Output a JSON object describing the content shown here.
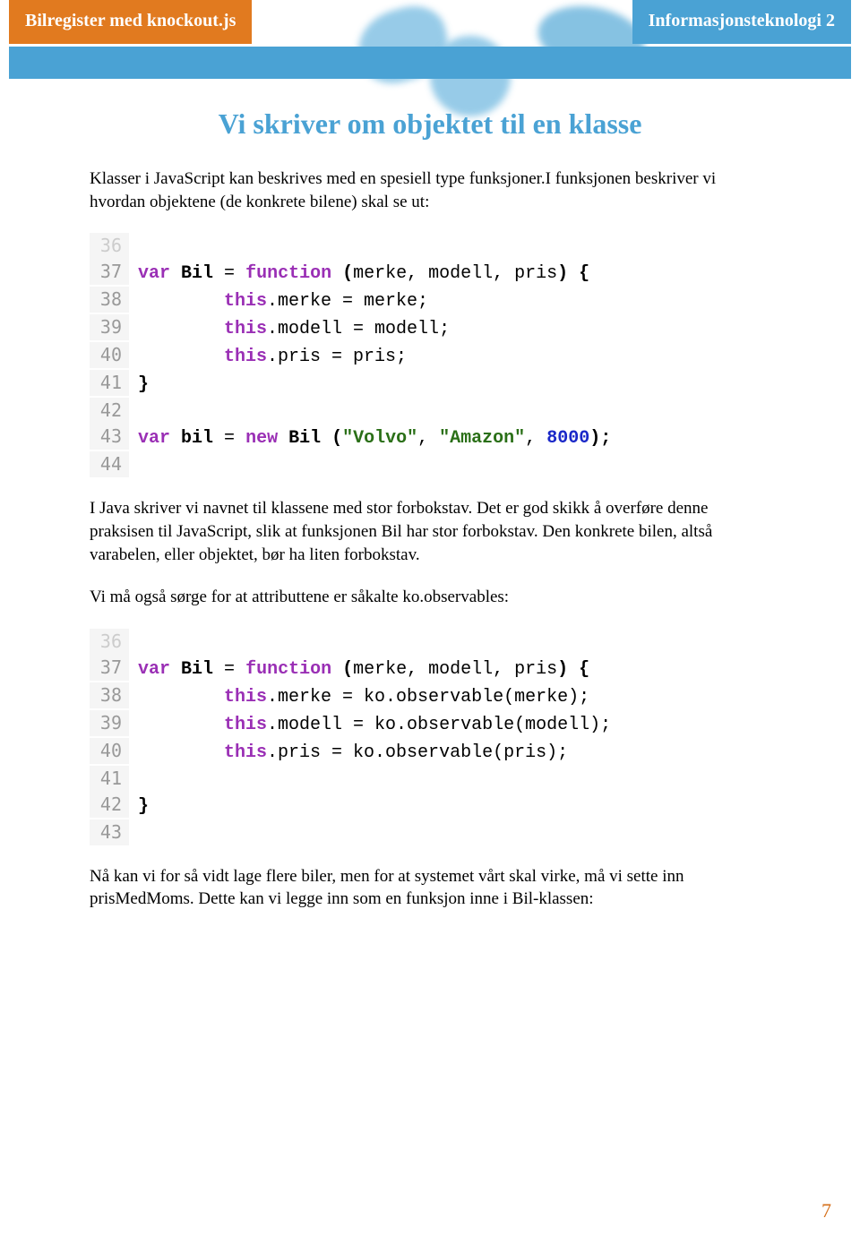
{
  "header": {
    "left_tab": "Bilregister med knockout.js",
    "right_tab": "Informasjonsteknologi 2"
  },
  "headings": {
    "title": "Vi skriver om objektet til en klasse"
  },
  "paragraphs": {
    "p1": "Klasser i JavaScript kan beskrives med en spesiell type funksjoner.I funksjonen beskriver vi hvordan objektene (de konkrete bilene) skal se ut:",
    "p2": "I Java skriver vi navnet til klassene med stor forbokstav. Det er god skikk å overføre denne praksisen til JavaScript, slik at funksjonen Bil har stor forbokstav. Den konkrete bilen, altså varabelen, eller objektet, bør ha liten forbokstav.",
    "p3": "Vi må også sørge for at attributtene er såkalte ko.observables:",
    "p4": "Nå kan vi for så vidt lage flere biler, men for at systemet vårt skal virke, må vi sette inn prisMedMoms. Dette kan vi legge inn som en funksjon inne i Bil-klassen:"
  },
  "code1": {
    "lines": [
      {
        "num": "36",
        "faint": true,
        "tokens": []
      },
      {
        "num": "37",
        "tokens": [
          {
            "t": "kw",
            "v": "var"
          },
          {
            "t": "plain",
            "v": " "
          },
          {
            "t": "id",
            "v": "Bil"
          },
          {
            "t": "plain",
            "v": " = "
          },
          {
            "t": "kw",
            "v": "function"
          },
          {
            "t": "plain",
            "v": " "
          },
          {
            "t": "paren",
            "v": "("
          },
          {
            "t": "plain",
            "v": "merke, modell, pris"
          },
          {
            "t": "paren",
            "v": ") {"
          }
        ]
      },
      {
        "num": "38",
        "indent": 2,
        "tokens": [
          {
            "t": "thisk",
            "v": "this"
          },
          {
            "t": "plain",
            "v": ".merke = merke;"
          }
        ]
      },
      {
        "num": "39",
        "indent": 2,
        "tokens": [
          {
            "t": "thisk",
            "v": "this"
          },
          {
            "t": "plain",
            "v": ".modell = modell;"
          }
        ]
      },
      {
        "num": "40",
        "indent": 2,
        "tokens": [
          {
            "t": "thisk",
            "v": "this"
          },
          {
            "t": "plain",
            "v": ".pris = pris;"
          }
        ]
      },
      {
        "num": "41",
        "tokens": [
          {
            "t": "paren",
            "v": "}"
          }
        ]
      },
      {
        "num": "42",
        "tokens": []
      },
      {
        "num": "43",
        "tokens": [
          {
            "t": "kw",
            "v": "var"
          },
          {
            "t": "plain",
            "v": " "
          },
          {
            "t": "id",
            "v": "bil"
          },
          {
            "t": "plain",
            "v": " = "
          },
          {
            "t": "kw",
            "v": "new"
          },
          {
            "t": "plain",
            "v": " "
          },
          {
            "t": "id",
            "v": "Bil"
          },
          {
            "t": "plain",
            "v": " "
          },
          {
            "t": "paren",
            "v": "("
          },
          {
            "t": "str",
            "v": "\"Volvo\""
          },
          {
            "t": "plain",
            "v": ", "
          },
          {
            "t": "str",
            "v": "\"Amazon\""
          },
          {
            "t": "plain",
            "v": ", "
          },
          {
            "t": "num",
            "v": "8000"
          },
          {
            "t": "paren",
            "v": ");"
          }
        ]
      },
      {
        "num": "44",
        "tokens": []
      }
    ]
  },
  "code2": {
    "lines": [
      {
        "num": "36",
        "faint": true,
        "tokens": []
      },
      {
        "num": "37",
        "tokens": [
          {
            "t": "kw",
            "v": "var"
          },
          {
            "t": "plain",
            "v": " "
          },
          {
            "t": "id",
            "v": "Bil"
          },
          {
            "t": "plain",
            "v": " = "
          },
          {
            "t": "kw",
            "v": "function"
          },
          {
            "t": "plain",
            "v": " "
          },
          {
            "t": "paren",
            "v": "("
          },
          {
            "t": "plain",
            "v": "merke, modell, pris"
          },
          {
            "t": "paren",
            "v": ") {"
          }
        ]
      },
      {
        "num": "38",
        "indent": 2,
        "tokens": [
          {
            "t": "thisk",
            "v": "this"
          },
          {
            "t": "plain",
            "v": ".merke = ko.observable(merke);"
          }
        ]
      },
      {
        "num": "39",
        "indent": 2,
        "tokens": [
          {
            "t": "thisk",
            "v": "this"
          },
          {
            "t": "plain",
            "v": ".modell = ko.observable(modell);"
          }
        ]
      },
      {
        "num": "40",
        "indent": 2,
        "tokens": [
          {
            "t": "thisk",
            "v": "this"
          },
          {
            "t": "plain",
            "v": ".pris = ko.observable(pris);"
          }
        ]
      },
      {
        "num": "41",
        "tokens": []
      },
      {
        "num": "42",
        "tokens": [
          {
            "t": "paren",
            "v": "}"
          }
        ]
      },
      {
        "num": "43",
        "tokens": []
      }
    ]
  },
  "page_number": "7"
}
